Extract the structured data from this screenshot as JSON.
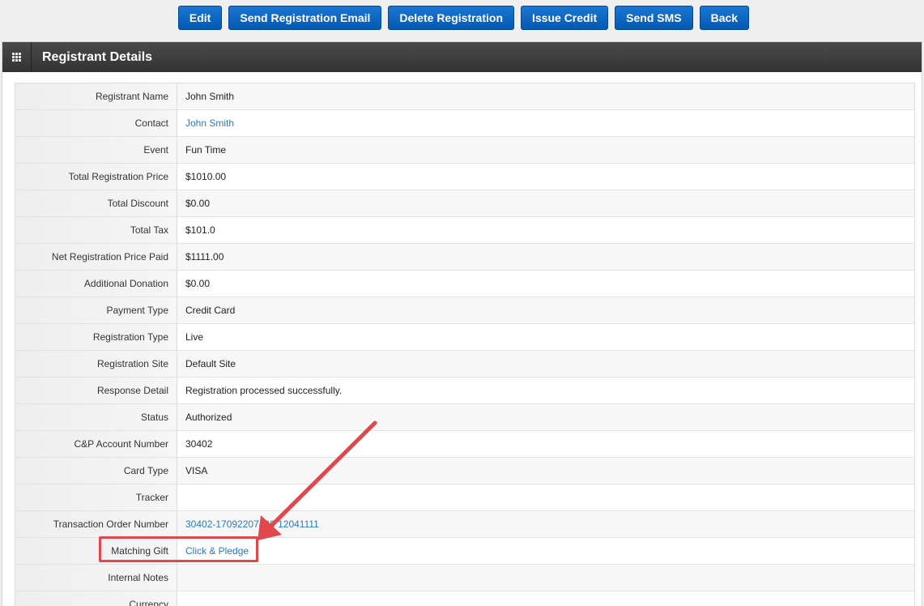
{
  "toolbar": {
    "buttons": [
      "Edit",
      "Send Registration Email",
      "Delete Registration",
      "Issue Credit",
      "Send SMS",
      "Back"
    ]
  },
  "panel": {
    "title": "Registrant Details",
    "icon": "grid-icon"
  },
  "rows": [
    {
      "label": "Registrant Name",
      "value": "John Smith",
      "link": false
    },
    {
      "label": "Contact",
      "value": "John Smith",
      "link": true
    },
    {
      "label": "Event",
      "value": "Fun Time",
      "link": false
    },
    {
      "label": "Total Registration Price",
      "value": "$1010.00",
      "link": false
    },
    {
      "label": "Total Discount",
      "value": "$0.00",
      "link": false
    },
    {
      "label": "Total Tax",
      "value": "$101.0",
      "link": false
    },
    {
      "label": "Net Registration Price Paid",
      "value": "$1111.00",
      "link": false
    },
    {
      "label": "Additional Donation",
      "value": "$0.00",
      "link": false
    },
    {
      "label": "Payment Type",
      "value": "Credit Card",
      "link": false
    },
    {
      "label": "Registration Type",
      "value": "Live",
      "link": false
    },
    {
      "label": "Registration Site",
      "value": "Default Site",
      "link": false
    },
    {
      "label": "Response Detail",
      "value": "Registration processed successfully.",
      "link": false
    },
    {
      "label": "Status",
      "value": "Authorized",
      "link": false
    },
    {
      "label": "C&P Account Number",
      "value": "30402",
      "link": false
    },
    {
      "label": "Card Type",
      "value": "VISA",
      "link": false
    },
    {
      "label": "Tracker",
      "value": "",
      "link": false
    },
    {
      "label": "Transaction Order Number",
      "value": "30402-17092207480 12041111",
      "link": true
    },
    {
      "label": "Matching Gift",
      "value": "Click & Pledge",
      "link": true
    },
    {
      "label": "Internal Notes",
      "value": "",
      "link": false
    },
    {
      "label": "Currency",
      "value": "",
      "link": false
    }
  ],
  "colors": {
    "button": "#0a67c2",
    "header": "#3d3d3d",
    "link": "#2a7ab9",
    "annotation": "#e2474c"
  }
}
